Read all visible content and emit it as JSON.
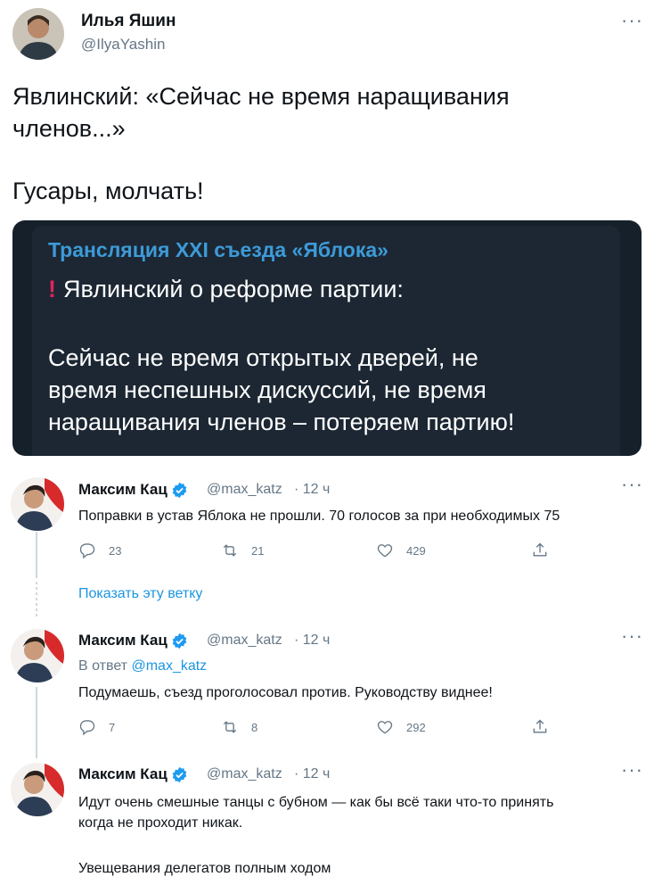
{
  "tweet": {
    "author_name": "Илья Яшин",
    "author_handle": "@IlyaYashin",
    "text_line1": "Явлинский: «Сейчас не время наращивания",
    "text_line2": "членов...»",
    "text_line3": "Гусары, молчать!",
    "more_label": "···",
    "card": {
      "title": "Трансляция XXI съезда «Яблока»",
      "exclamation": "!",
      "subtitle": "Явлинский о реформе партии:",
      "quote_line1": "Сейчас не время открытых дверей, не",
      "quote_line2": "время неспешных дискуссий, не время",
      "quote_line3": "наращивания членов – потеряем партию!"
    }
  },
  "replies": [
    {
      "name": "Максим Кац",
      "handle": "@max_katz",
      "time": "· 12 ч",
      "text": "Поправки в устав Яблока не прошли. 70 голосов за при необходимых 75",
      "reply_count": "23",
      "retweet_count": "21",
      "like_count": "429"
    },
    {
      "name": "Максим Кац",
      "handle": "@max_katz",
      "time": "· 12 ч",
      "reply_to_prefix": "В ответ",
      "reply_to_handle": "@max_katz",
      "text": "Подумаешь, съезд проголосовал против. Руководству виднее!",
      "reply_count": "7",
      "retweet_count": "8",
      "like_count": "292"
    },
    {
      "name": "Максим Кац",
      "handle": "@max_katz",
      "time": "· 12 ч",
      "text_line1": "Идут очень смешные танцы с бубном — как бы всё таки что-то принять",
      "text_line2": "когда не проходит никак.",
      "text_line3": "Увещевания делегатов полным ходом"
    }
  ],
  "show_thread": "Показать эту ветку",
  "icons": {
    "verified": "verified-badge-icon",
    "reply": "reply-icon",
    "retweet": "retweet-icon",
    "like": "heart-icon",
    "share": "share-icon"
  },
  "colors": {
    "accent": "#1b95e0",
    "muted": "#657786",
    "card_bg": "#15202b",
    "card_title": "#3d9bd8",
    "exclamation": "#e0245e"
  }
}
